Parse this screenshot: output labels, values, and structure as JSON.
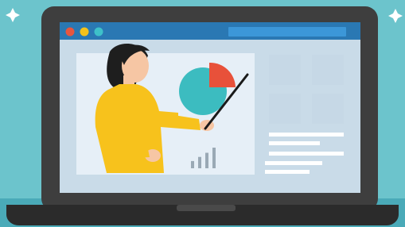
{
  "illustration": {
    "colors": {
      "background": "#6cc4cc",
      "background_dark": "#4aaab8",
      "laptop_body": "#3e3e3e",
      "laptop_base": "#2b2b2b",
      "screen_bg": "#c9dbe8",
      "panel_bg": "#e6eff7",
      "browser_bar": "#2a78b3",
      "address_bar": "#3c97d8",
      "dot_red": "#e8563f",
      "dot_yellow": "#f4c21a",
      "dot_teal": "#3ec1c9",
      "pie_main": "#3cbcc0",
      "pie_slice": "#e8513a",
      "shirt": "#f7c21c",
      "skin": "#f6c6a4",
      "hair": "#1e1e1e",
      "tiles": "#c6d8e6",
      "text_lines": "#ffffff"
    },
    "icons": [
      "sparkle-icon",
      "pie-chart-icon",
      "bar-chart-icon",
      "pointer-stick-icon"
    ],
    "bar_chart_levels": [
      0.35,
      0.55,
      0.75,
      1.0
    ],
    "pie_highlight_fraction": 0.22
  }
}
